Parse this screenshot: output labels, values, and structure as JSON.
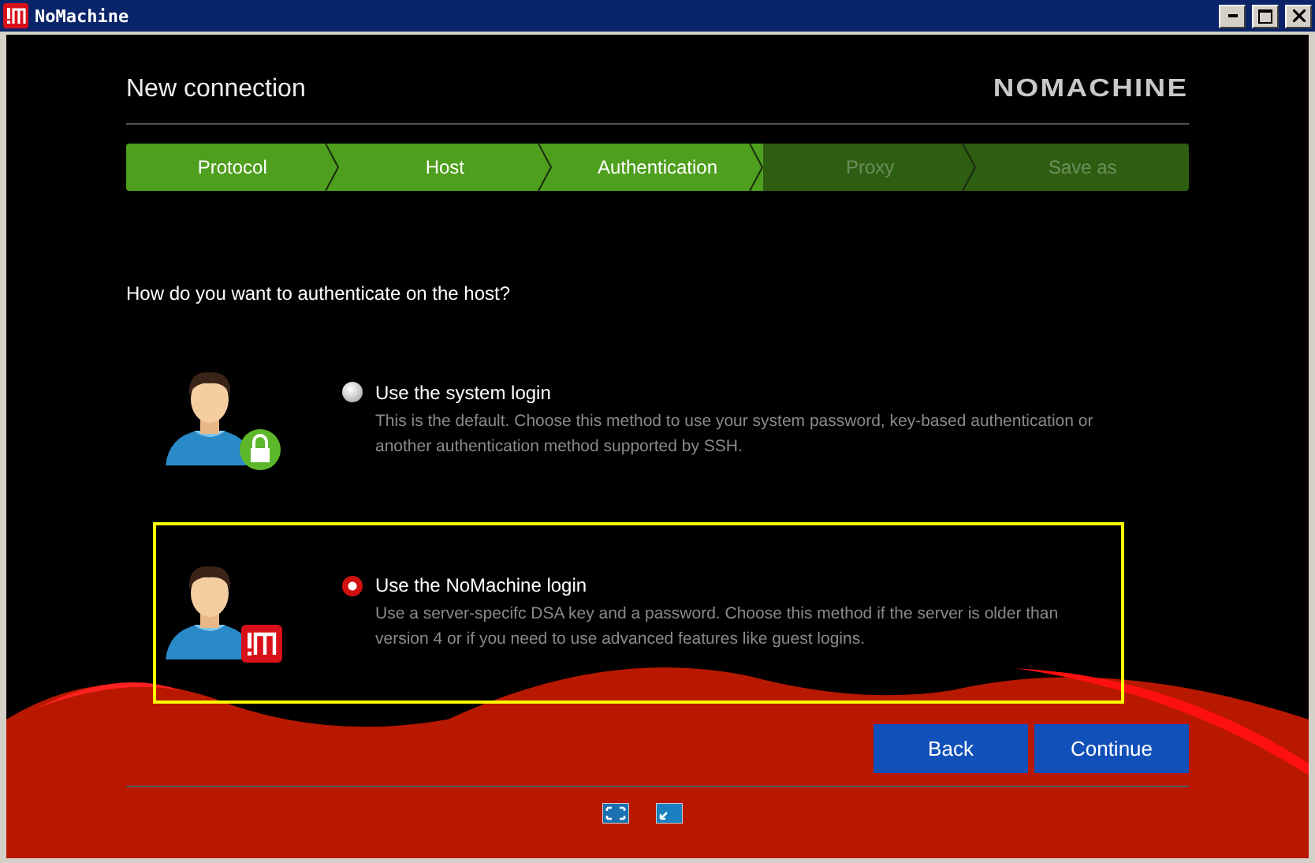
{
  "window": {
    "title": "NoMachine"
  },
  "header": {
    "title": "New connection",
    "logo": "NOMACHINE"
  },
  "steps": [
    {
      "label": "Protocol",
      "done": true
    },
    {
      "label": "Host",
      "done": true
    },
    {
      "label": "Authentication",
      "done": true
    },
    {
      "label": "Proxy",
      "done": false
    },
    {
      "label": "Save as",
      "done": false
    }
  ],
  "question": "How do you want to authenticate on the host?",
  "options": [
    {
      "kind": "lock",
      "title": "Use the system login",
      "description": "This is the default. Choose this method to use your system password, key-based authentication or another authentication method supported by SSH.",
      "selected": false
    },
    {
      "kind": "nomachine",
      "title": "Use the NoMachine login",
      "description": "Use a server-specifc DSA key and a password. Choose this method if the server is older than version 4 or if you need to use advanced features like guest logins.",
      "selected": true
    }
  ],
  "buttons": [
    "Back",
    "Continue"
  ]
}
